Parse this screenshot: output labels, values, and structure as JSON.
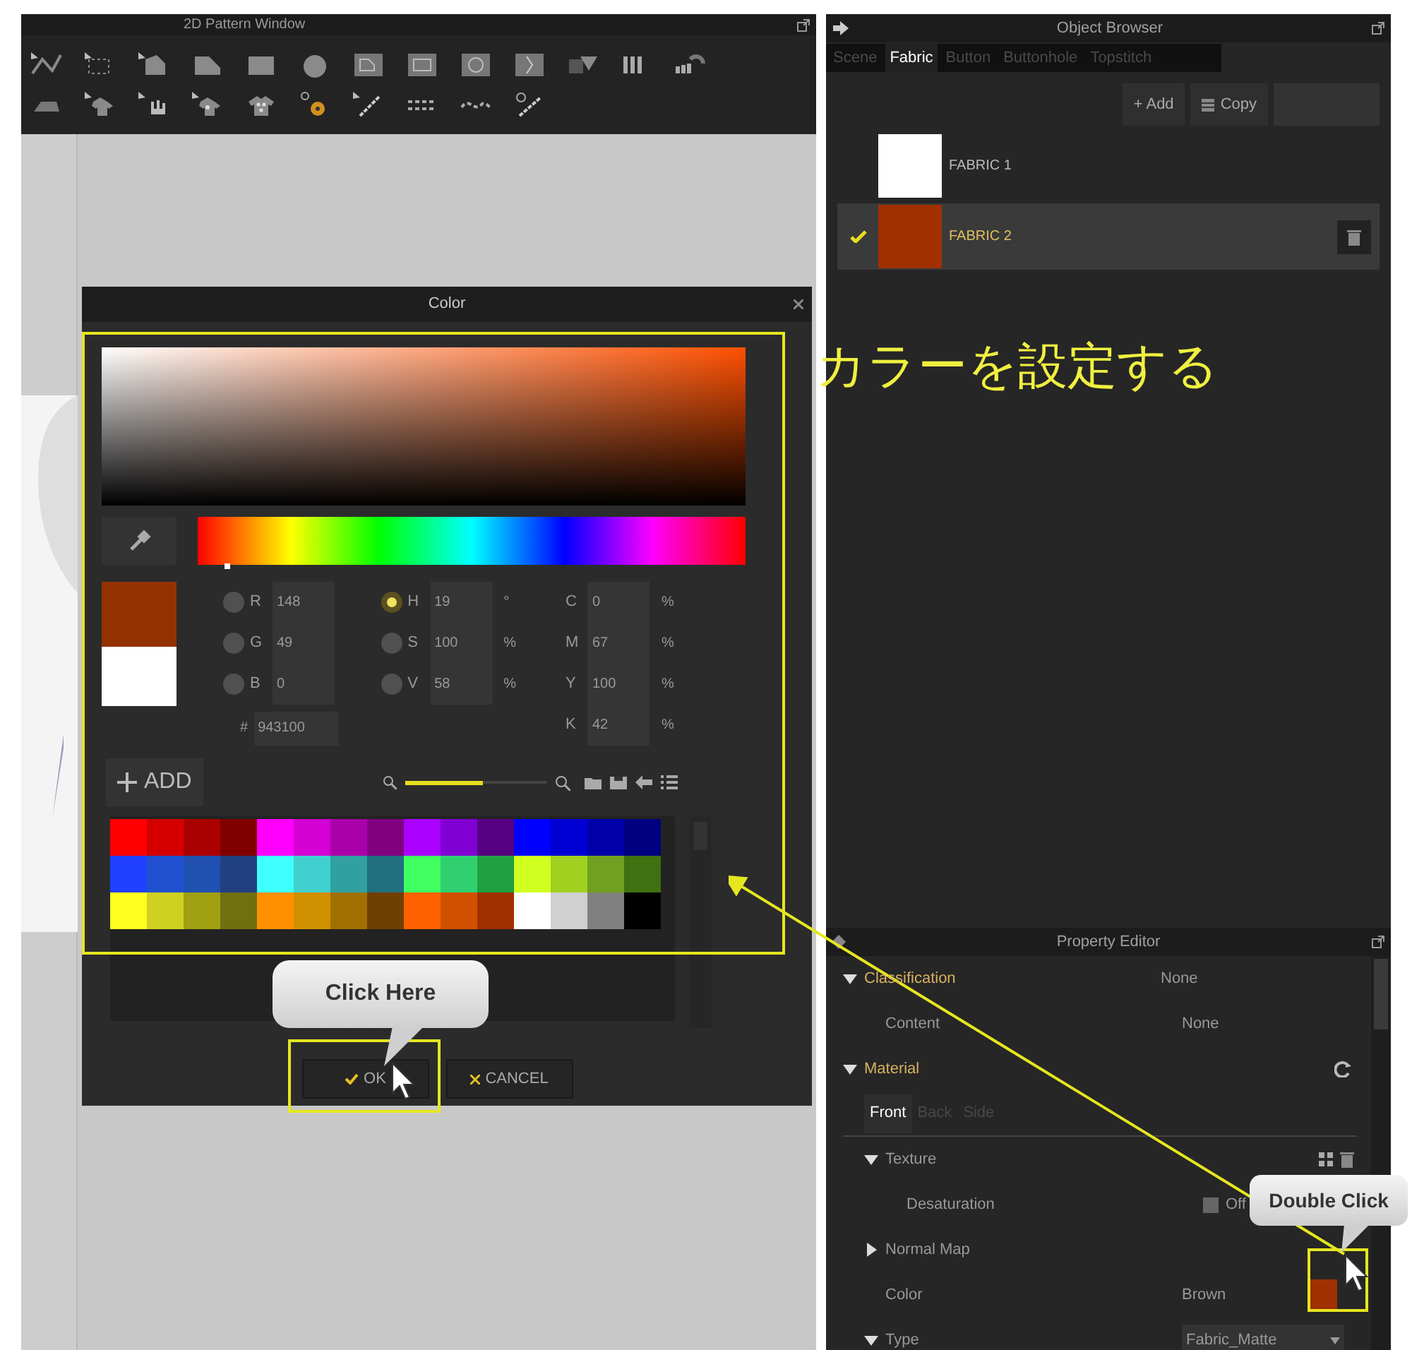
{
  "pattern_window": {
    "title": "2D Pattern Window"
  },
  "color_dialog": {
    "title": "Color",
    "preview": [
      {
        "color": "#943100"
      },
      {
        "color": "#ffffff"
      }
    ],
    "rgb": [
      {
        "label": "R",
        "value": "148",
        "selected": false
      },
      {
        "label": "G",
        "value": "49",
        "selected": false
      },
      {
        "label": "B",
        "value": "0",
        "selected": false
      }
    ],
    "hsv": [
      {
        "label": "H",
        "value": "19",
        "unit": "°",
        "selected": true
      },
      {
        "label": "S",
        "value": "100",
        "unit": "%",
        "selected": false
      },
      {
        "label": "V",
        "value": "58",
        "unit": "%",
        "selected": false
      }
    ],
    "cmyk": [
      {
        "label": "C",
        "value": "0",
        "unit": "%"
      },
      {
        "label": "M",
        "value": "67",
        "unit": "%"
      },
      {
        "label": "Y",
        "value": "100",
        "unit": "%"
      },
      {
        "label": "K",
        "value": "42",
        "unit": "%"
      }
    ],
    "hex": {
      "prefix": "#",
      "value": "943100"
    },
    "add_button": "ADD",
    "hue": {
      "level": 0.05
    },
    "zoom": {
      "level": 0.55
    },
    "palette": [
      [
        {
          "color": "#ff0000"
        },
        {
          "color": "#d40000"
        },
        {
          "color": "#aa0000"
        },
        {
          "color": "#800000"
        },
        {
          "color": "#ff00ff"
        },
        {
          "color": "#d400d4"
        },
        {
          "color": "#aa00aa"
        },
        {
          "color": "#800080"
        },
        {
          "color": "#aa00ff"
        },
        {
          "color": "#8000d4"
        },
        {
          "color": "#550080"
        },
        {
          "color": "#0000ff"
        },
        {
          "color": "#0000d4"
        },
        {
          "color": "#0000aa"
        },
        {
          "color": "#000080"
        }
      ],
      [
        {
          "color": "#2040ff"
        },
        {
          "color": "#2050d0"
        },
        {
          "color": "#2050b0"
        },
        {
          "color": "#204080"
        },
        {
          "color": "#40ffff"
        },
        {
          "color": "#40d0d0"
        },
        {
          "color": "#30a0a0"
        },
        {
          "color": "#207080"
        },
        {
          "color": "#40ff60"
        },
        {
          "color": "#30d070"
        },
        {
          "color": "#20a040"
        },
        {
          "color": "#d0ff20"
        },
        {
          "color": "#a0d020"
        },
        {
          "color": "#70a020"
        },
        {
          "color": "#407010"
        }
      ],
      [
        {
          "color": "#ffff20"
        },
        {
          "color": "#d0d020"
        },
        {
          "color": "#a0a010"
        },
        {
          "color": "#707010"
        },
        {
          "color": "#ff9000"
        },
        {
          "color": "#d09000"
        },
        {
          "color": "#a07000"
        },
        {
          "color": "#704000"
        },
        {
          "color": "#ff6000"
        },
        {
          "color": "#d05000"
        },
        {
          "color": "#a03000"
        },
        {
          "color": "#ffffff"
        },
        {
          "color": "#d0d0d0"
        },
        {
          "color": "#808080"
        },
        {
          "color": "#000000"
        }
      ]
    ],
    "buttons": [
      {
        "kind": "ok",
        "label": "OK"
      },
      {
        "kind": "cancel",
        "label": "CANCEL"
      }
    ]
  },
  "object_browser": {
    "title": "Object Browser",
    "tabs": [
      {
        "label": "Scene",
        "selected": false
      },
      {
        "label": "Fabric",
        "selected": true
      },
      {
        "label": "Button",
        "selected": false
      },
      {
        "label": "Buttonhole",
        "selected": false
      },
      {
        "label": "Topstitch",
        "selected": false
      }
    ],
    "actions": [
      {
        "label": "+ Add",
        "disabled": false
      },
      {
        "label": "Copy",
        "disabled": false
      }
    ],
    "fabrics": [
      {
        "name": "FABRIC 1",
        "color": "#ffffff",
        "selected": false
      },
      {
        "name": "FABRIC 2",
        "color": "#a03000",
        "selected": true
      }
    ]
  },
  "property_editor": {
    "title": "Property Editor",
    "rows": [
      {
        "kind": "section",
        "label": "Classification",
        "value": "None",
        "expanded": true,
        "children": [
          {
            "kind": "value",
            "label": "Content",
            "value": "None"
          }
        ]
      },
      {
        "kind": "section",
        "label": "Material",
        "expanded": true,
        "children": [
          {
            "kind": "tabs",
            "tabs": [
              {
                "label": "Front",
                "selected": true
              },
              {
                "label": "Back",
                "selected": false
              },
              {
                "label": "Side",
                "selected": false
              }
            ]
          },
          {
            "kind": "group",
            "label": "Texture",
            "expanded": true,
            "children": [
              {
                "kind": "toggle",
                "label": "Desaturation",
                "value": "Off",
                "checked": false
              }
            ]
          },
          {
            "kind": "group",
            "label": "Normal Map",
            "expanded": false
          },
          {
            "kind": "color",
            "label": "Color",
            "value": "Brown",
            "color": "#a03000"
          },
          {
            "kind": "dropdown",
            "label": "Type",
            "value": "Fabric_Matte",
            "expanded": true
          }
        ]
      }
    ]
  },
  "annotations": {
    "heading": "カラーを設定する",
    "callouts": [
      {
        "kind": "ok",
        "text": "Click Here"
      },
      {
        "kind": "swatch",
        "text": "Double Click"
      }
    ]
  }
}
